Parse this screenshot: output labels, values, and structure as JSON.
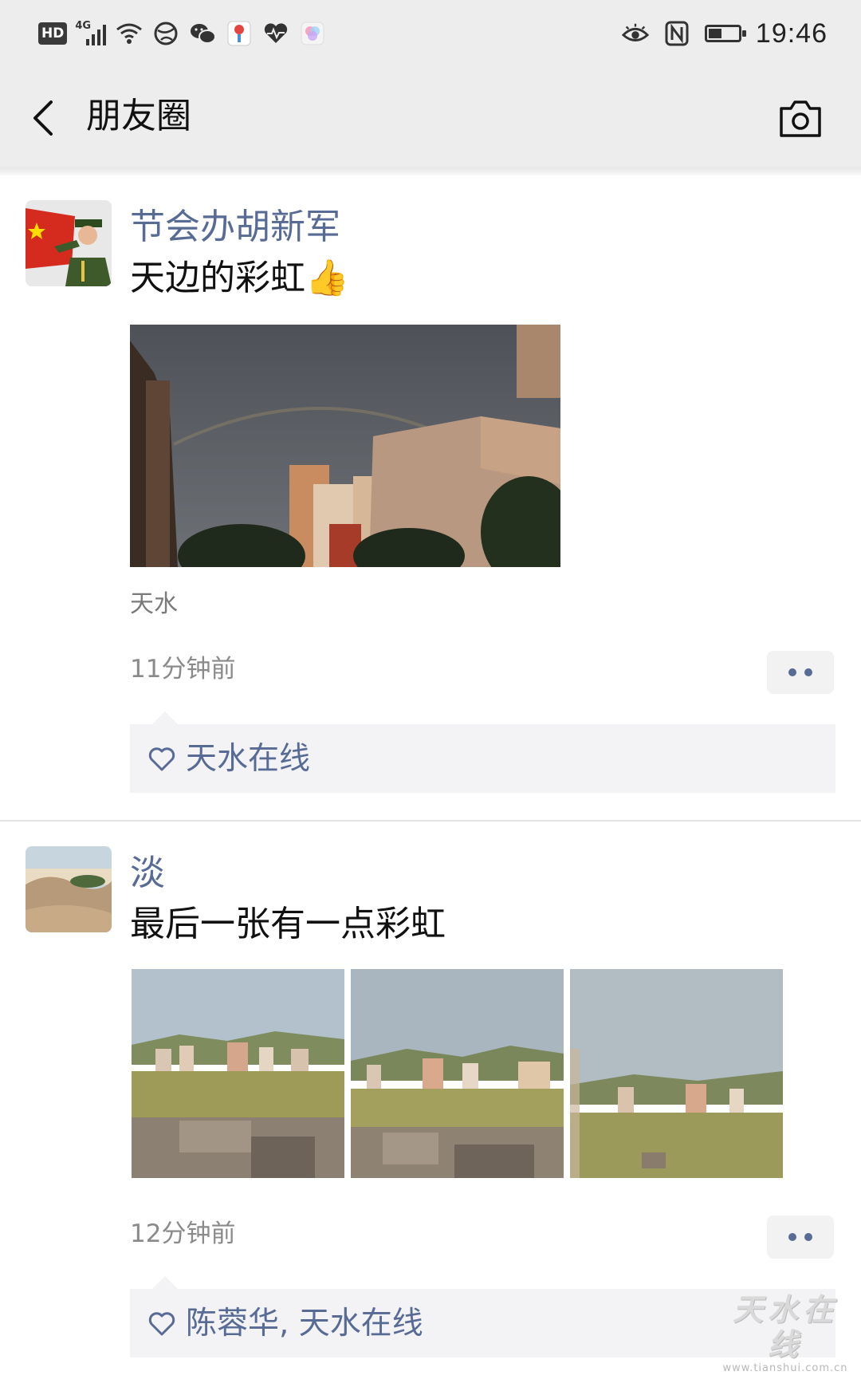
{
  "status_bar": {
    "hd": "HD",
    "network": "4G",
    "time": "19:46",
    "icons": [
      "signal-icon",
      "wifi-icon",
      "vpn-globe-icon",
      "wechat-icon",
      "app-icon",
      "health-heart-icon",
      "color-app-icon",
      "eye-icon",
      "nfc-icon",
      "battery-icon"
    ]
  },
  "nav": {
    "title": "朋友圈",
    "back_icon": "chevron-left-icon",
    "camera_icon": "camera-icon"
  },
  "posts": [
    {
      "author": "节会办胡新军",
      "text": "天边的彩虹👍",
      "photos": [
        "rainbow-over-buildings-photo"
      ],
      "location": "天水",
      "time": "11分钟前",
      "likes": "天水在线"
    },
    {
      "author": "淡",
      "text": "最后一张有一点彩虹",
      "photos": [
        "city-view-photo-1",
        "city-view-photo-2",
        "city-view-photo-3"
      ],
      "time": "12分钟前",
      "likes": "陈蓉华, 天水在线"
    }
  ],
  "watermark": {
    "brand": "天水在线",
    "url": "www.tianshui.com.cn"
  },
  "colors": {
    "link": "#576b95",
    "bar_bg": "#ededed",
    "likes_bg": "#f3f3f5"
  }
}
